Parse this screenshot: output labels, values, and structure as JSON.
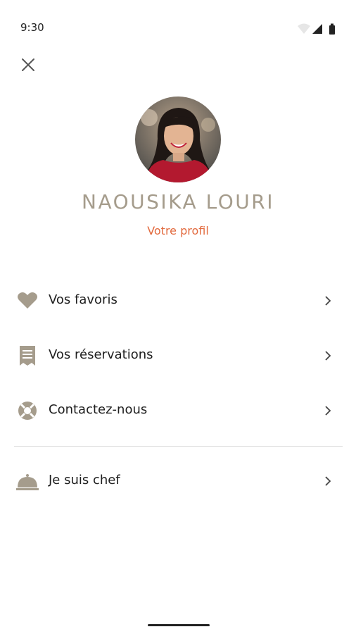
{
  "status_bar": {
    "time": "9:30"
  },
  "profile": {
    "name": "NAOUSIKA LOURI",
    "link_label": "Votre profil"
  },
  "menu": {
    "items": [
      {
        "label": "Vos favoris",
        "icon": "heart-icon"
      },
      {
        "label": "Vos réservations",
        "icon": "receipt-icon"
      },
      {
        "label": "Contactez-nous",
        "icon": "lifebuoy-icon"
      },
      {
        "label": "Je suis chef",
        "icon": "service-bell-icon"
      }
    ]
  },
  "colors": {
    "accent": "#a59c8c",
    "link": "#e26a3e",
    "text": "#1e1e1e"
  }
}
